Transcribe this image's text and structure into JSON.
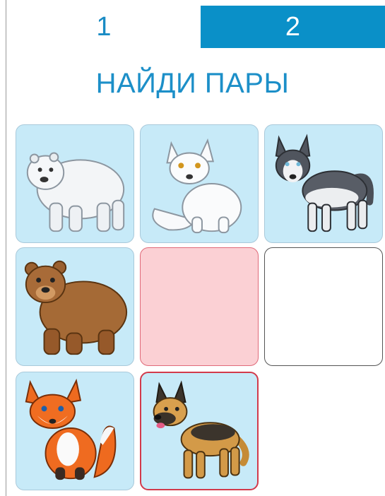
{
  "tabs": [
    {
      "label": "1",
      "active": false
    },
    {
      "label": "2",
      "active": true
    }
  ],
  "title": "НАЙДИ ПАРЫ",
  "colors": {
    "accent": "#0a90c8",
    "card_face": "#c7eaf8",
    "card_wrong": "#fbd0d4",
    "wrong_border": "#e06a79",
    "selected_border": "#d23a4b"
  },
  "cards": [
    {
      "animal": "polar-bear",
      "state": "face-up"
    },
    {
      "animal": "arctic-fox",
      "state": "face-up"
    },
    {
      "animal": "husky",
      "state": "face-up"
    },
    {
      "animal": "brown-bear",
      "state": "face-up"
    },
    {
      "animal": "",
      "state": "mismatch"
    },
    {
      "animal": "",
      "state": "face-down"
    },
    {
      "animal": "red-fox",
      "state": "face-up"
    },
    {
      "animal": "german-shepherd",
      "state": "selected"
    }
  ]
}
